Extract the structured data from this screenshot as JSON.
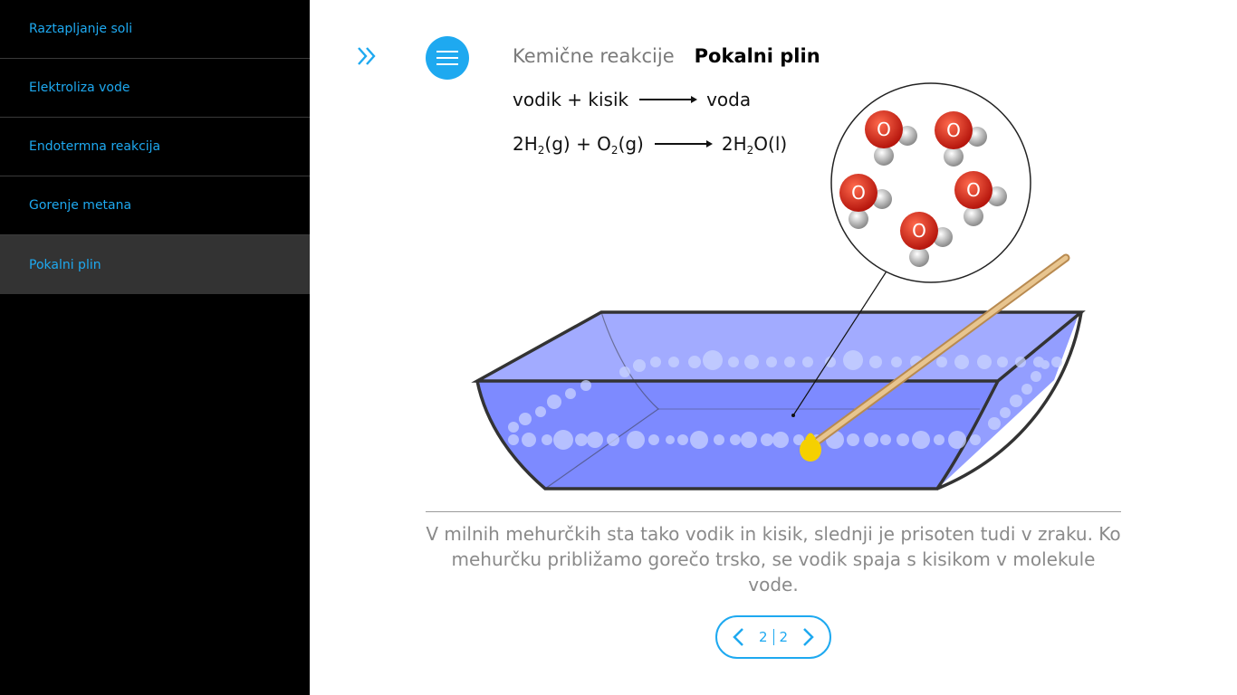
{
  "sidebar": {
    "items": [
      {
        "label": "Raztapljanje soli"
      },
      {
        "label": "Elektroliza vode"
      },
      {
        "label": "Endotermna reakcija"
      },
      {
        "label": "Gorenje metana"
      },
      {
        "label": "Pokalni plin"
      }
    ],
    "active_index": 4
  },
  "header": {
    "crumb": "Kemične reakcije",
    "topic": "Pokalni plin"
  },
  "equation_words": {
    "reactants": "vodik + kisik",
    "product": "voda"
  },
  "equation_formula": {
    "coef1": "2H",
    "sub1": "2",
    "state1": "(g) + O",
    "sub2": "2",
    "state2": "(g)",
    "coef3": "2H",
    "sub3": "2",
    "rest3": "O(l)"
  },
  "molecule_atom_label": "O",
  "caption": "V milnih mehurčkih sta tako vodik in kisik, slednji je prisoten tudi v zraku. Ko mehurčku približamo gorečo trsko, se vodik spaja s kisikom v molekule vode.",
  "pager": {
    "current": "2",
    "total": "2"
  },
  "colors": {
    "accent": "#1ea9f0",
    "sidebar_bg": "#000000",
    "sidebar_active": "#333333",
    "water": "#6f7dff",
    "oxygen": "#d8261a",
    "hydrogen": "#bdbdbd",
    "flame": "#f5d000",
    "stick": "#d9b07a"
  },
  "icons": {
    "expand": "double-chevron-right-icon",
    "menu": "hamburger-icon",
    "prev": "chevron-left-icon",
    "next": "chevron-right-icon"
  }
}
